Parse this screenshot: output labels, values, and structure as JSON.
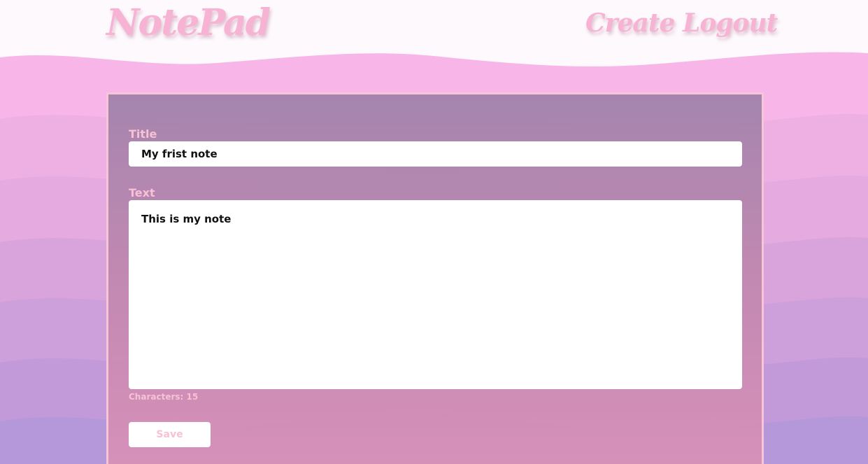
{
  "app": {
    "logo_text": "NotePad"
  },
  "nav": {
    "create_label": "Create",
    "logout_label": "Logout"
  },
  "form": {
    "title_label": "Title",
    "title_value": "My frist note",
    "text_label": "Text",
    "text_value": "This is my note",
    "char_count_text": "Characters: 15",
    "save_label": "Save"
  },
  "colors": {
    "header_bg": "#fdf9fc",
    "accent_pink": "#f7b3d3",
    "label_pink": "#f8c1d6",
    "wave_top": "#f7b5e8",
    "wave_bottom": "#b197d9"
  },
  "icons": []
}
